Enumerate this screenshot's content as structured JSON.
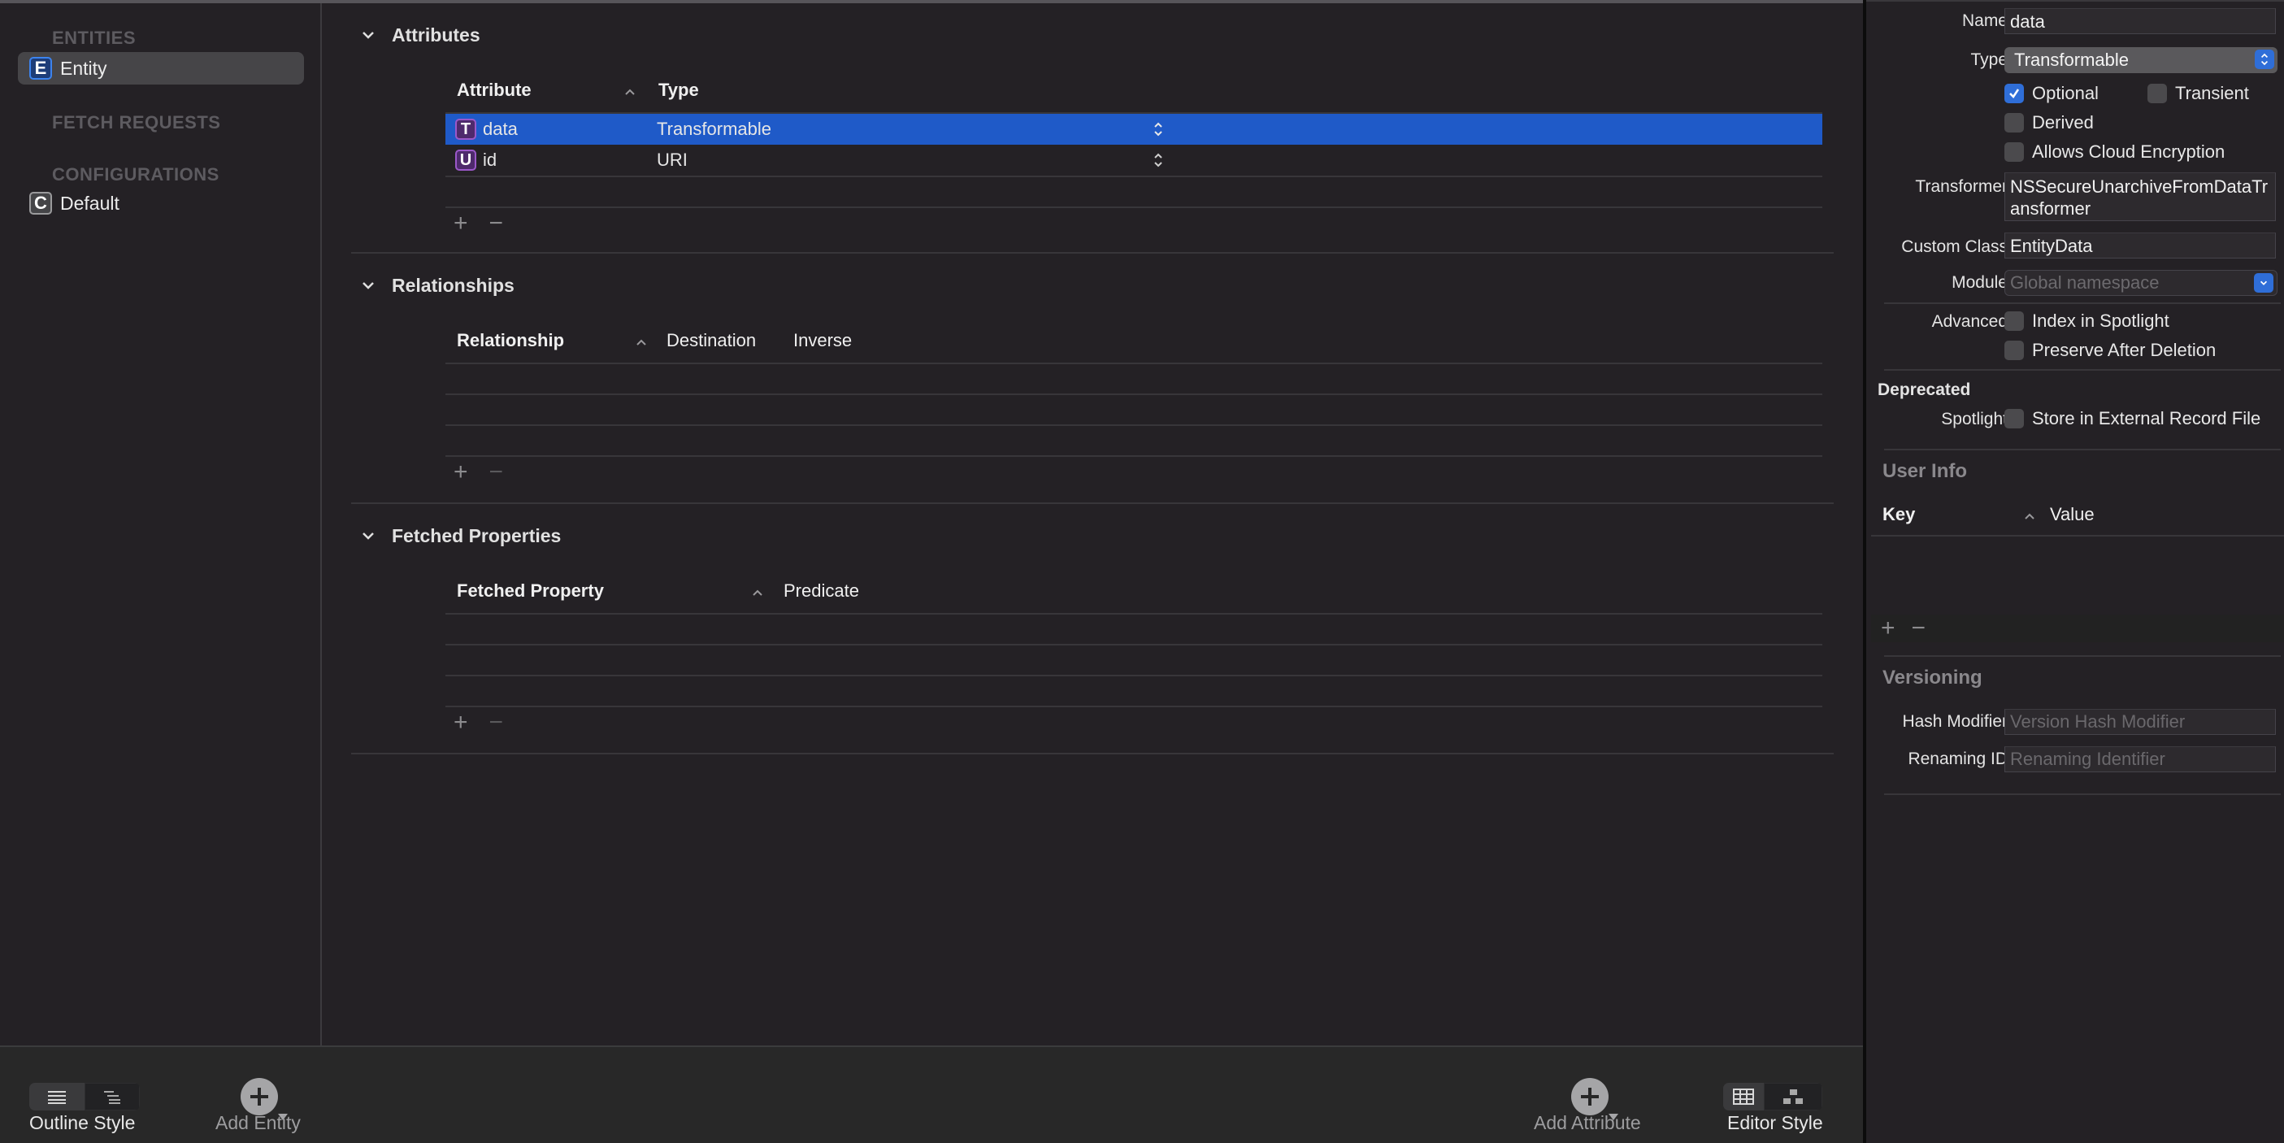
{
  "sidebar": {
    "sections": {
      "entities": "ENTITIES",
      "fetch_requests": "FETCH REQUESTS",
      "configurations": "CONFIGURATIONS"
    },
    "entities": [
      {
        "badge": "E",
        "label": "Entity",
        "selected": true
      }
    ],
    "configurations": [
      {
        "badge": "C",
        "label": "Default",
        "selected": false
      }
    ]
  },
  "editor": {
    "attributes": {
      "title": "Attributes",
      "columns": [
        "Attribute",
        "Type"
      ],
      "rows": [
        {
          "badge": "T",
          "name": "data",
          "type": "Transformable",
          "selected": true
        },
        {
          "badge": "U",
          "name": "id",
          "type": "URI",
          "selected": false
        }
      ],
      "add": "+",
      "remove": "−"
    },
    "relationships": {
      "title": "Relationships",
      "columns": [
        "Relationship",
        "Destination",
        "Inverse"
      ],
      "rows": [],
      "add": "+",
      "remove": "−"
    },
    "fetched_properties": {
      "title": "Fetched Properties",
      "columns": [
        "Fetched Property",
        "Predicate"
      ],
      "rows": [],
      "add": "+",
      "remove": "−"
    }
  },
  "bottom_bar": {
    "outline_style_label": "Outline Style",
    "add_entity_label": "Add Entity",
    "add_attribute_label": "Add Attribute",
    "editor_style_label": "Editor Style"
  },
  "inspector": {
    "name_label": "Name",
    "name_value": "data",
    "type_label": "Type",
    "type_value": "Transformable",
    "optional_label": "Optional",
    "optional_checked": true,
    "transient_label": "Transient",
    "transient_checked": false,
    "derived_label": "Derived",
    "derived_checked": false,
    "cloud_encryption_label": "Allows Cloud Encryption",
    "cloud_encryption_checked": false,
    "transformer_label": "Transformer",
    "transformer_value": "NSSecureUnarchiveFromDataTransformer",
    "custom_class_label": "Custom Class",
    "custom_class_value": "EntityData",
    "module_label": "Module",
    "module_placeholder": "Global namespace",
    "advanced_label": "Advanced",
    "index_spotlight_label": "Index in Spotlight",
    "preserve_deletion_label": "Preserve After Deletion",
    "deprecated_label": "Deprecated",
    "spotlight_label": "Spotlight",
    "external_record_label": "Store in External Record File",
    "user_info": {
      "title": "User Info",
      "columns": [
        "Key",
        "Value"
      ],
      "add": "+",
      "remove": "−"
    },
    "versioning": {
      "title": "Versioning",
      "hash_modifier_label": "Hash Modifier",
      "hash_modifier_placeholder": "Version Hash Modifier",
      "renaming_id_label": "Renaming ID",
      "renaming_id_placeholder": "Renaming Identifier"
    }
  },
  "colors": {
    "selection": "#1f5ac8",
    "checkbox_checked": "#2f6ed8",
    "background": "#242125"
  }
}
